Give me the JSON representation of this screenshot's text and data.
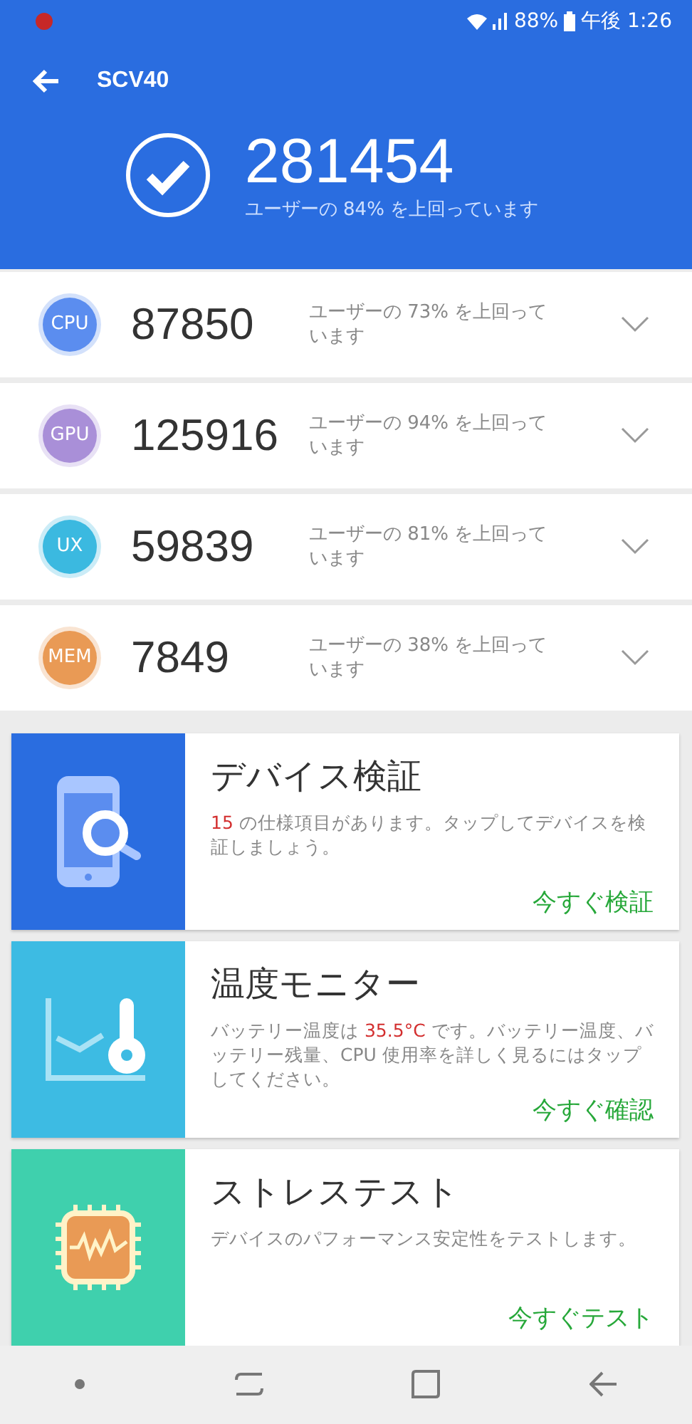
{
  "status_bar": {
    "battery": "88%",
    "time": "午後 1:26"
  },
  "header": {
    "title": "SCV40",
    "total_score": "281454",
    "percentile": "ユーザーの 84% を上回っています"
  },
  "scores": [
    {
      "label": "CPU",
      "color": "#5b8def",
      "score": "87850",
      "percentile": "ユーザーの 73% を上回っています",
      "expanded": false
    },
    {
      "label": "GPU",
      "color": "#a98fd8",
      "score": "125916",
      "percentile": "ユーザーの 94% を上回っています",
      "expanded": false
    },
    {
      "label": "UX",
      "color": "#3bb9e0",
      "score": "59839",
      "percentile": "ユーザーの 81% を上回っています",
      "expanded": false
    },
    {
      "label": "MEM",
      "color": "#e99a55",
      "score": "7849",
      "percentile": "ユーザーの 38% を上回っています",
      "expanded": false
    }
  ],
  "cards": [
    {
      "kind": "device",
      "color": "#2a6de0",
      "title": "デバイス検証",
      "body": "**15** の仕様項目があります。タップしてデバイスを検証しましょう。",
      "action": "今すぐ検証"
    },
    {
      "kind": "temperature",
      "color": "#3dbbe3",
      "title": "温度モニター",
      "body": "バッテリー温度は **35.5°C** です。バッテリー温度、バッテリー残量、CPU 使用率を詳しく見るにはタップしてください。",
      "action": "今すぐ確認"
    },
    {
      "kind": "stress",
      "color": "#3fd0ad",
      "title": "ストレステスト",
      "body": "デバイスのパフォーマンス安定性をテストします。",
      "action": "今すぐテスト"
    }
  ]
}
